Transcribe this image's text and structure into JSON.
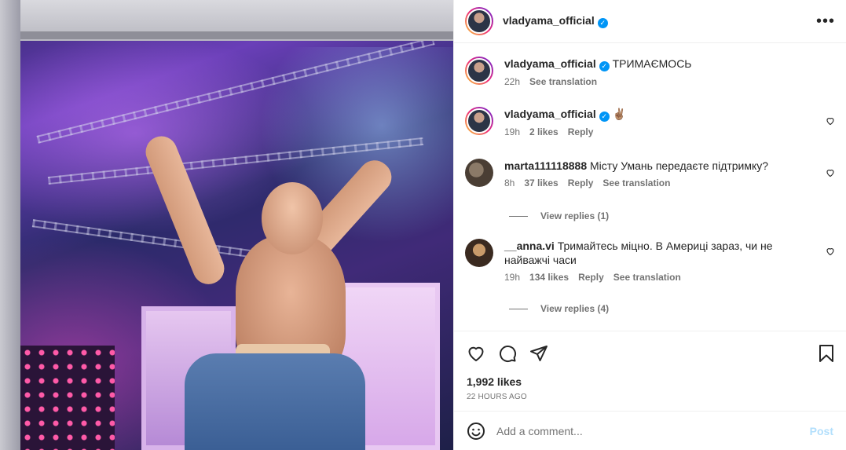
{
  "post": {
    "author": "vladyama_official",
    "caption": "ТРИМАЄМОСЬ",
    "caption_time": "22h",
    "see_translation": "See translation",
    "likes": "1,992 likes",
    "time_ago": "22 HOURS AGO",
    "photo_icon": "post-photo"
  },
  "comments": [
    {
      "username": "vladyama_official",
      "text": "✌🏽",
      "time": "19h",
      "likes": "2 likes",
      "reply": "Reply",
      "verified": true
    },
    {
      "username": "marta111118888",
      "text": "Місту Умань передаєте підтримку?",
      "time": "8h",
      "likes": "37 likes",
      "reply": "Reply",
      "see_translation": "See translation",
      "view_replies": "View replies (1)"
    },
    {
      "username": "__anna.vi",
      "text": "Тримайтесь міцно. В Америці зараз, чи не найважчі часи",
      "time": "19h",
      "likes": "134 likes",
      "reply": "Reply",
      "see_translation": "See translation",
      "view_replies": "View replies (4)"
    }
  ],
  "composer": {
    "placeholder": "Add a comment...",
    "post_label": "Post"
  },
  "colors": {
    "accent": "#0095f6",
    "post_disabled": "#b2dffc",
    "muted": "#737373"
  }
}
